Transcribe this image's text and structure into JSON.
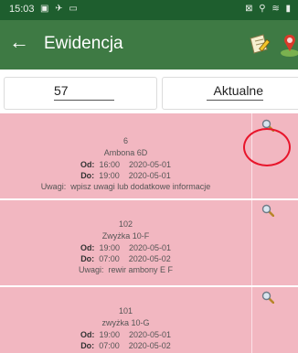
{
  "status": {
    "time": "15:03"
  },
  "appbar": {
    "title": "Ewidencja"
  },
  "filters": {
    "left_value": "57",
    "right_value": "Aktualne"
  },
  "labels": {
    "od": "Od:",
    "do": "Do:",
    "uwagi": "Uwagi:"
  },
  "items": [
    {
      "number": "6",
      "name": "Ambona 6D",
      "od_time": "16:00",
      "od_date": "2020-05-01",
      "do_time": "19:00",
      "do_date": "2020-05-01",
      "uwagi": "wpisz uwagi lub dodatkowe informacje"
    },
    {
      "number": "102",
      "name": "Zwyżka 10-F",
      "od_time": "19:00",
      "od_date": "2020-05-01",
      "do_time": "07:00",
      "do_date": "2020-05-02",
      "uwagi": "rewir ambony E F"
    },
    {
      "number": "101",
      "name": "zwyżka 10-G",
      "od_time": "19:00",
      "od_date": "2020-05-01",
      "do_time": "07:00",
      "do_date": "2020-05-02",
      "uwagi": ""
    }
  ],
  "colors": {
    "status_bar": "#1e5e2e",
    "app_bar": "#3e7a44",
    "item_bg": "#f2b7c1",
    "highlight": "#e8152b"
  }
}
